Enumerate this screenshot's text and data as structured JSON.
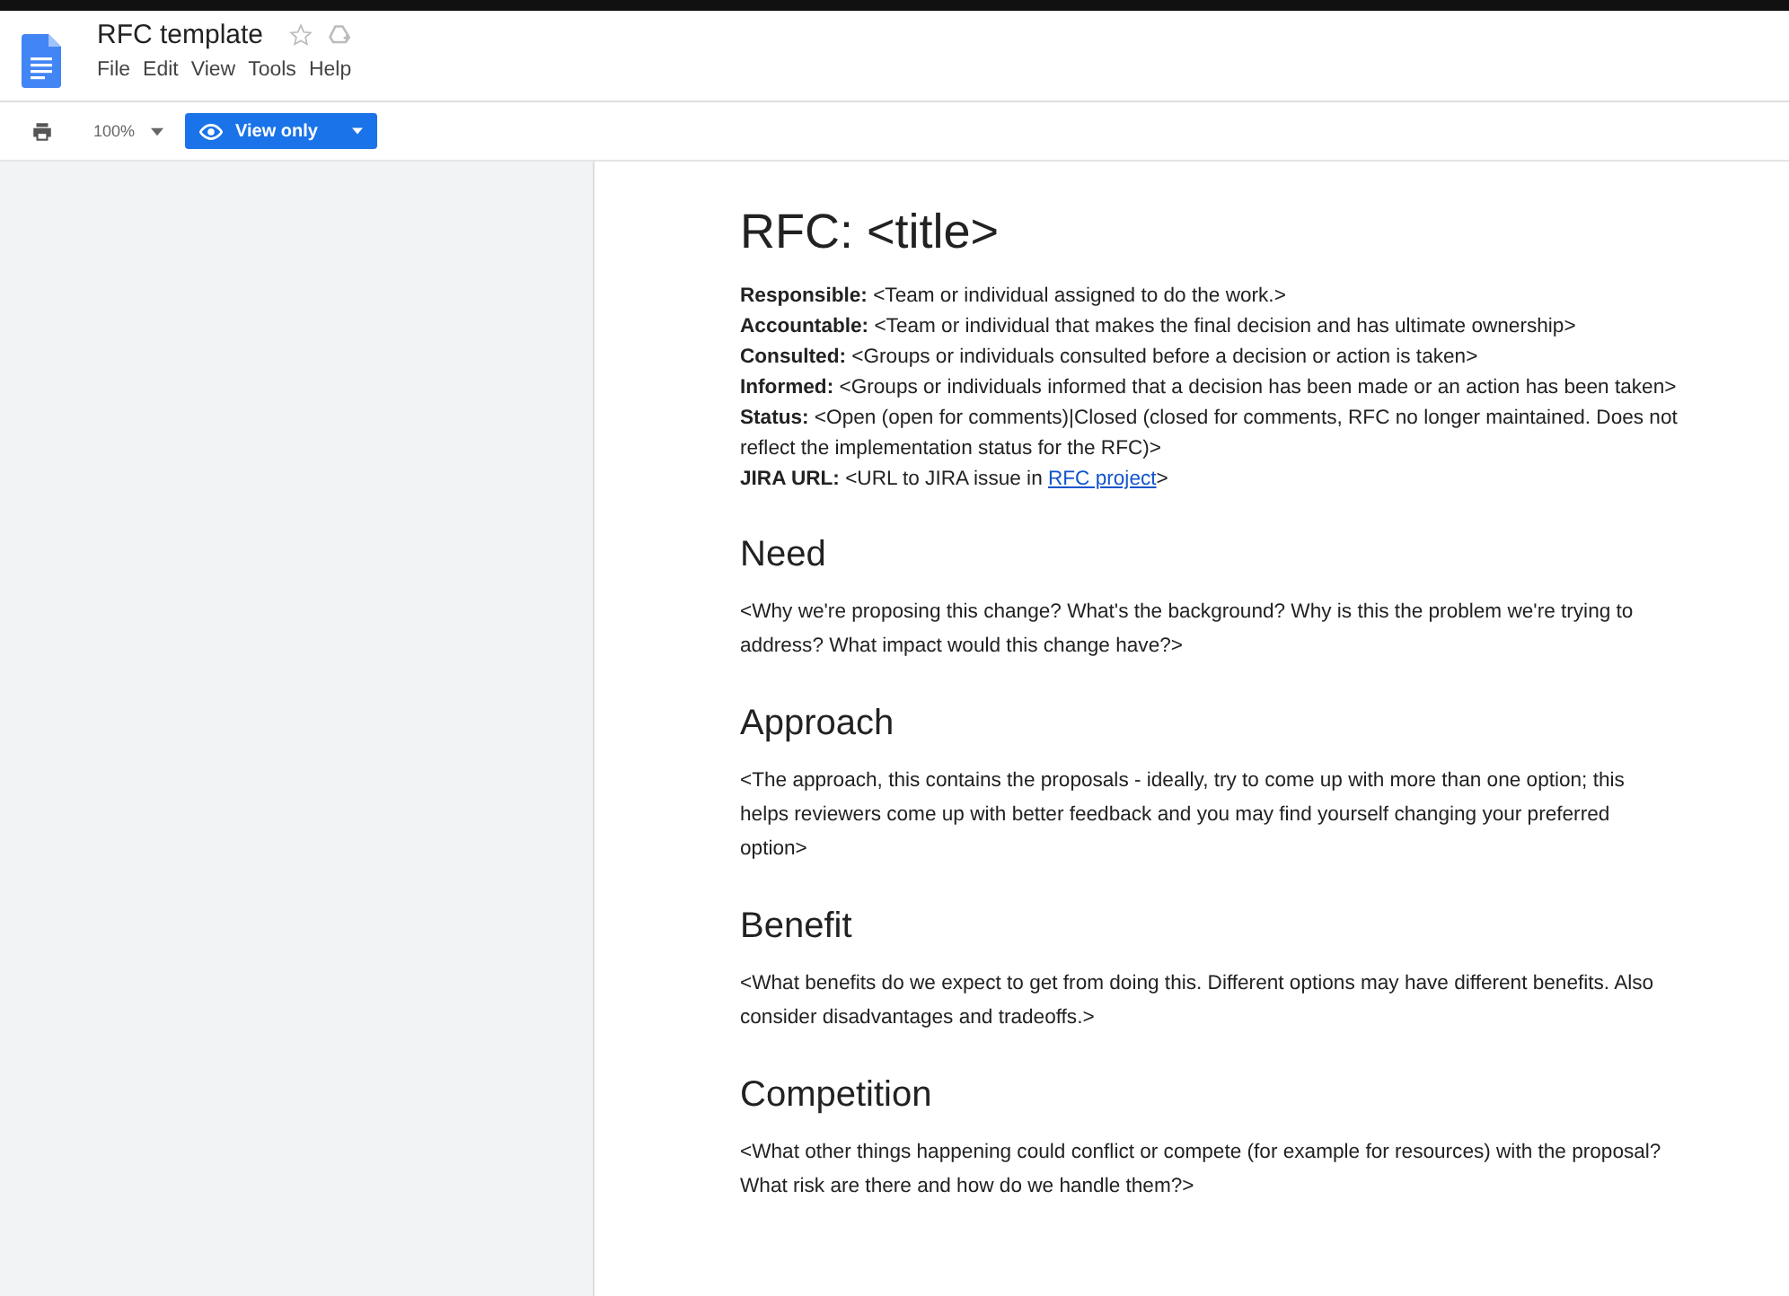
{
  "document": {
    "title": "RFC template",
    "starred": false
  },
  "menu": [
    "File",
    "Edit",
    "View",
    "Tools",
    "Help"
  ],
  "toolbar": {
    "zoom": "100%",
    "mode": "View only"
  },
  "page": {
    "title": "RFC: <title>",
    "fields": [
      {
        "label": "Responsible:",
        "text": " <Team or individual assigned to do the work.>"
      },
      {
        "label": "Accountable:",
        "text": " <Team or individual that makes the final decision and has ultimate ownership>"
      },
      {
        "label": "Consulted:",
        "text": " <Groups or individuals consulted before a decision or action is taken>"
      },
      {
        "label": "Informed:",
        "text": " <Groups or individuals informed that a decision has been made or an action has been taken>"
      },
      {
        "label": "Status:",
        "text": " <Open (open for comments)|Closed (closed for comments, RFC no longer maintained. Does not reflect the implementation status for the RFC)>"
      },
      {
        "label": "JIRA URL:",
        "text": " <URL to JIRA issue in ",
        "link": "RFC project",
        "after": ">"
      }
    ],
    "sections": [
      {
        "heading": "Need",
        "body": "<Why we're proposing this change? What's the background? Why is this the problem we're trying to address? What impact would this change have?>"
      },
      {
        "heading": "Approach",
        "body": "<The approach, this contains the proposals - ideally, try to come up with more than one option; this helps reviewers come up with better feedback and you may find yourself changing your preferred option>"
      },
      {
        "heading": "Benefit",
        "body": "<What benefits do we expect to get from doing this. Different options may have different benefits. Also consider disadvantages and tradeoffs.>"
      },
      {
        "heading": "Competition",
        "body": "<What other things happening could conflict or compete (for example for resources) with the proposal? What risk are there and how do we handle them?>"
      }
    ]
  }
}
